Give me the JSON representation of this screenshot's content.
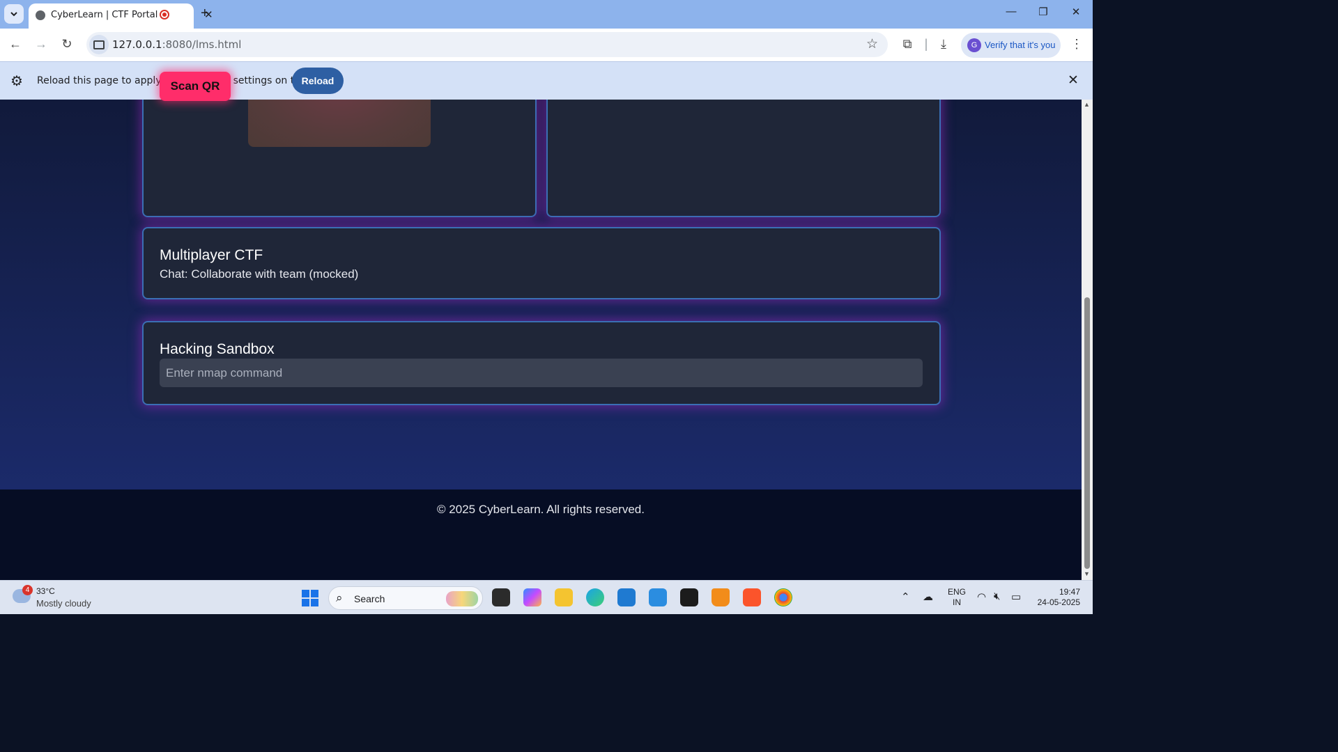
{
  "browser": {
    "tab_title": "CyberLearn | CTF Portal",
    "tab_close": "✕",
    "new_tab": "+",
    "url_host": "127.0.0.1",
    "url_path": ":8080/lms.html",
    "profile_initial": "G",
    "profile_text": "Verify that it's you",
    "window_controls": [
      "—",
      "❐",
      "✕"
    ]
  },
  "infobar": {
    "message": "Reload this page to apply your updated settings on this site",
    "reload_label": "Reload",
    "close": "✕"
  },
  "page": {
    "qr_card": {
      "scan_button": "Scan QR"
    },
    "multiplayer": {
      "title": "Multiplayer CTF",
      "description": "Chat: Collaborate with team (mocked)"
    },
    "sandbox": {
      "title": "Hacking Sandbox",
      "input_placeholder": "Enter nmap command"
    },
    "footer": "© 2025 CyberLearn. All rights reserved."
  },
  "taskbar": {
    "weather_badge": "4",
    "temperature": "33°C",
    "condition": "Mostly cloudy",
    "search_label": "Search",
    "lang_top": "ENG",
    "lang_bottom": "IN",
    "time": "19:47",
    "date": "24-05-2025"
  },
  "colors": {
    "accent_pink": "#ff2d6a",
    "card_border": "#3a6fb4",
    "card_glow": "#9628be",
    "reload_button": "#2e5fa3"
  }
}
